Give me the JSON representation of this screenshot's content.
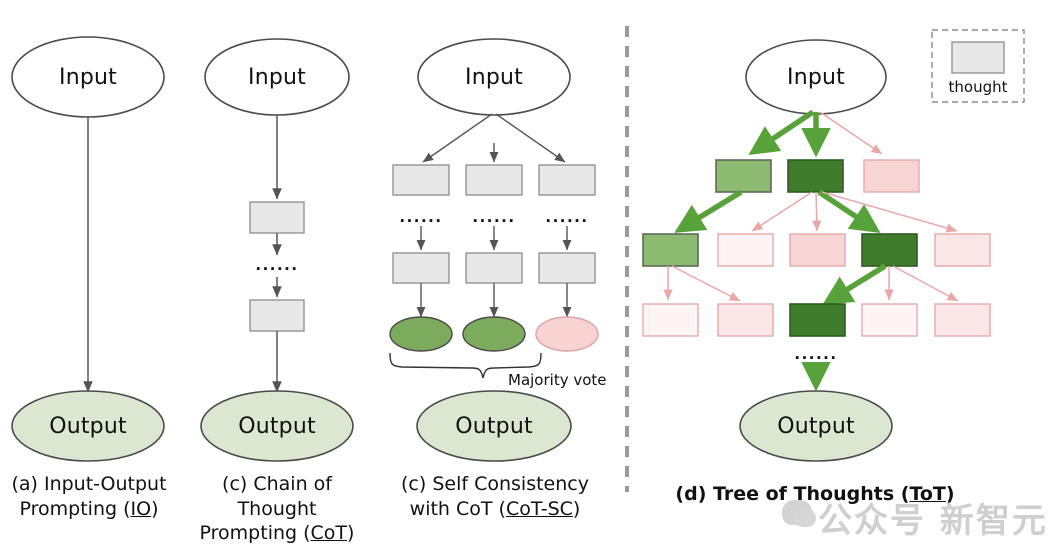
{
  "figure": {
    "title_hidden": "",
    "watermark": {
      "text": "公众号 新智元",
      "logo_icon": "wechat-logo-icon"
    }
  },
  "colors": {
    "ellipse_input_fill": "#ffffff",
    "ellipse_output_fill": "#dbe7d0",
    "ellipse_stroke": "#4a4a4a",
    "thought_fill": "#e8e8e8",
    "thought_stroke": "#8c8c8c",
    "green_dark": "#3f7c2c",
    "green_mid": "#8cba70",
    "green_arrow": "#57a33a",
    "pink_strong": "#f7d5d5",
    "pink_soft": "#fbe7e7",
    "pink_pale": "#fdf5f5",
    "pink_stroke": "#e8a9a9",
    "ellipse_pink_fill": "#f9d2d2",
    "ellipse_green_fill": "#7cab5d",
    "divider": "#9a9a9a",
    "arrow_gray": "#555555"
  },
  "panels": [
    {
      "id": "io",
      "caption_line1": "(a) Input-Output",
      "caption_line2_pre": "Prompting (",
      "caption_line2_u": "IO",
      "caption_line2_post": ")",
      "input_label": "Input",
      "output_label": "Output"
    },
    {
      "id": "cot",
      "caption_line1": "(c) Chain of Thought",
      "caption_line2_pre": "Prompting (",
      "caption_line2_u": "CoT",
      "caption_line2_post": ")",
      "input_label": "Input",
      "output_label": "Output",
      "ellipsis": "......"
    },
    {
      "id": "cot-sc",
      "caption_line1": "(c) Self Consistency",
      "caption_line2_pre": "with CoT (",
      "caption_line2_u": "CoT-SC",
      "caption_line2_post": ")",
      "input_label": "Input",
      "output_label": "Output",
      "majority_vote_label": "Majority vote",
      "ellipsis": "......",
      "branch_ellipses": [
        "......",
        "......",
        "......"
      ],
      "leaf_outcomes": [
        "green",
        "green",
        "pink"
      ]
    },
    {
      "id": "tot",
      "caption_pre": "(d) Tree of Thoughts (",
      "caption_u": "ToT",
      "caption_post": ")",
      "input_label": "Input",
      "output_label": "Output",
      "ellipsis": "......",
      "tree_rows": [
        {
          "row": 1,
          "nodes": [
            "green_mid",
            "green_dark",
            "pink_strong"
          ]
        },
        {
          "row": 2,
          "nodes": [
            "green_mid",
            "pink_pale",
            "pink_strong",
            "green_dark",
            "pink_soft"
          ]
        },
        {
          "row": 3,
          "nodes": [
            "pink_pale",
            "pink_soft",
            "green_dark",
            "pink_pale",
            "pink_soft"
          ]
        }
      ]
    }
  ],
  "legend": {
    "swatch_icon": "thought-box-icon",
    "label": "thought"
  }
}
